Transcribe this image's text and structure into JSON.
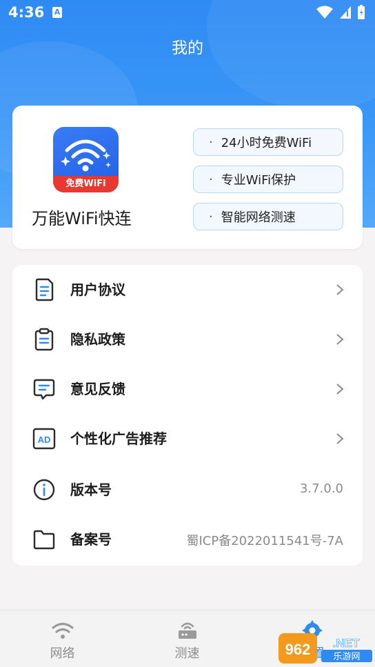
{
  "status": {
    "time": "4:36",
    "a_badge": "A"
  },
  "header": {
    "title": "我的"
  },
  "app_card": {
    "app_name": "万能WiFi快连",
    "icon_badge": "免费WiFi",
    "tags": [
      "24小时免费WiFi",
      "专业WiFi保护",
      "智能网络测速"
    ],
    "tag_dot": "·"
  },
  "menu": {
    "items": [
      {
        "label": "用户协议",
        "icon": "document-icon",
        "value": ""
      },
      {
        "label": "隐私政策",
        "icon": "clipboard-icon",
        "value": ""
      },
      {
        "label": "意见反馈",
        "icon": "chat-icon",
        "value": ""
      },
      {
        "label": "个性化广告推荐",
        "icon": "ad-icon",
        "value": ""
      },
      {
        "label": "版本号",
        "icon": "info-icon",
        "value": "3.7.0.0"
      },
      {
        "label": "备案号",
        "icon": "folder-icon",
        "value": "蜀ICP备2022011541号-7A"
      }
    ]
  },
  "bottom_nav": {
    "items": [
      {
        "label": "网络",
        "icon": "wifi-icon"
      },
      {
        "label": "测速",
        "icon": "router-icon"
      },
      {
        "label": "设置",
        "icon": "settings-icon"
      }
    ]
  },
  "watermark": {
    "brand": "962.NET",
    "sub": "乐游网"
  },
  "colors": {
    "primary": "#2f8bf4",
    "badge_red": "#e8382f",
    "icon_blue": "#2f8bf4"
  }
}
